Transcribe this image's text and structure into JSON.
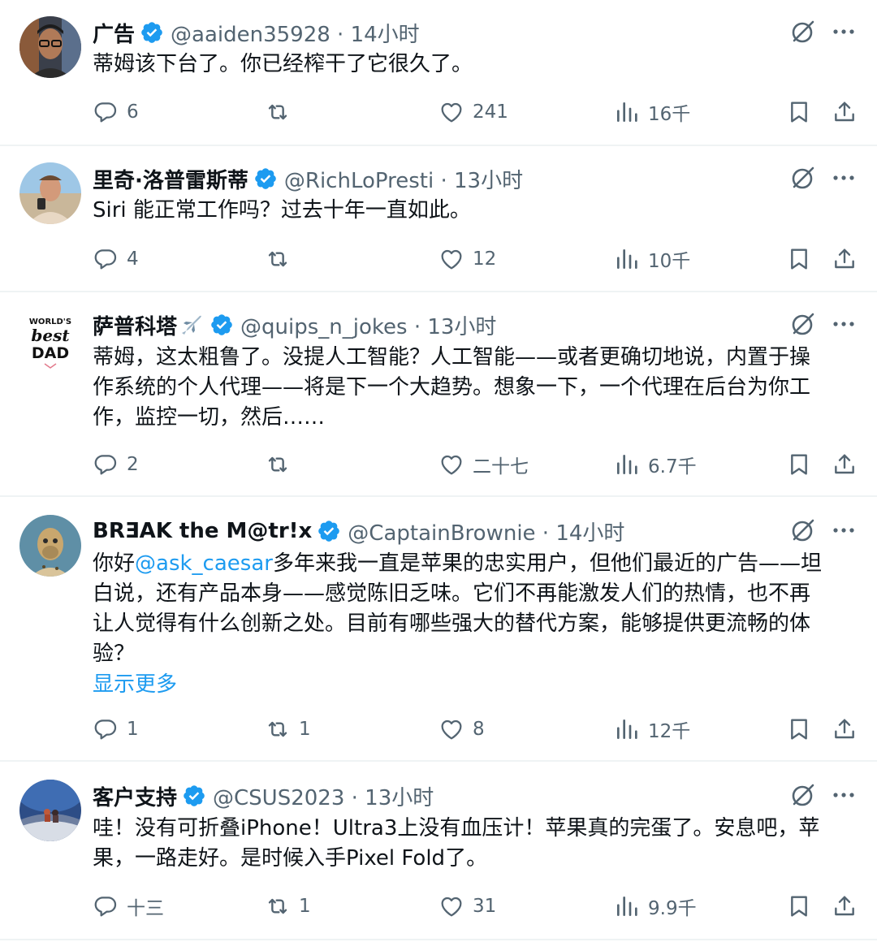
{
  "colors": {
    "accent": "#1d9bf0",
    "secondary": "#536471",
    "text": "#0f1419",
    "divider": "#eff3f4"
  },
  "tweets": [
    {
      "name": "广告",
      "handle": "@aaiden35928 · 14小时",
      "text": "蒂姆该下台了。你已经榨干了它很久了。",
      "replies": "6",
      "retweets": "",
      "likes": "241",
      "views": "16千"
    },
    {
      "name": "里奇·洛普雷斯蒂",
      "handle": "@RichLoPresti · 13小时",
      "text": "Siri 能正常工作吗？过去十年一直如此。",
      "replies": "4",
      "retweets": "",
      "likes": "12",
      "views": "10千"
    },
    {
      "name": "萨普科塔",
      "name_emoji": "airplane-emoji",
      "handle": "@quips_n_jokes · 13小时",
      "text_lines": [
        "蒂姆，这太粗鲁了。没提人工智能？人工智能——或者更确切地说，内置于操",
        "作系统的个人代理——将是下一个大趋势。想象一下，一个代理在后台为你工",
        "作，监控一切，然后……"
      ],
      "avatar_lines": [
        "WORLD'S",
        "best",
        "DAD"
      ],
      "replies": "2",
      "retweets": "",
      "likes": "二十七",
      "views": "6.7千"
    },
    {
      "name": "BRƎAK the M@tr!x",
      "handle": "@CaptainBrownie · 14小时",
      "text_prefix": "你好",
      "mention": "@ask_caesar",
      "text_lines": [
        "多年来我一直是苹果的忠实用户，但他们最近的广告——坦",
        "白说，还有产品本身——感觉陈旧乏味。它们不再能激发人们的热情，也不再",
        "让人觉得有什么创新之处。目前有哪些强大的替代方案，能够提供更流畅的体",
        "验？"
      ],
      "show_more": "显示更多",
      "replies": "1",
      "retweets": "1",
      "likes": "8",
      "views": "12千"
    },
    {
      "name": "客户支持",
      "handle": "@CSUS2023 · 13小时",
      "text_lines": [
        "哇！没有可折叠iPhone！Ultra3上没有血压计！苹果真的完蛋了。安息吧，苹",
        "果，一路走好。是时候入手Pixel Fold了。"
      ],
      "replies": "十三",
      "retweets": "1",
      "likes": "31",
      "views": "9.9千"
    }
  ]
}
